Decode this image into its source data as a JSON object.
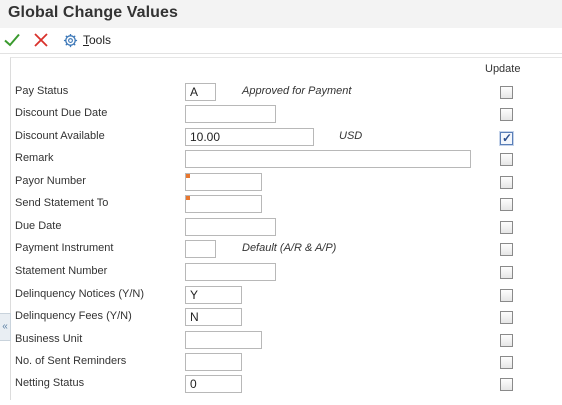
{
  "window": {
    "title": "Global Change Values"
  },
  "toolbar": {
    "tools_label": "Tools",
    "tools_underline": "T",
    "tools_rest": "ools"
  },
  "columns": {
    "update": "Update"
  },
  "fields": {
    "pay_status": {
      "label": "Pay Status",
      "value": "A",
      "description": "Approved for Payment"
    },
    "discount_due_date": {
      "label": "Discount Due Date",
      "value": ""
    },
    "discount_available": {
      "label": "Discount Available",
      "value": "10.00",
      "currency": "USD"
    },
    "remark": {
      "label": "Remark",
      "value": ""
    },
    "payor_number": {
      "label": "Payor Number",
      "value": ""
    },
    "send_statement_to": {
      "label": "Send Statement To",
      "value": ""
    },
    "due_date": {
      "label": "Due Date",
      "value": ""
    },
    "payment_instrument": {
      "label": "Payment Instrument",
      "value": "",
      "description": "Default (A/R & A/P)"
    },
    "statement_number": {
      "label": "Statement Number",
      "value": ""
    },
    "delinquency_notices": {
      "label": "Delinquency Notices (Y/N)",
      "value": "Y"
    },
    "delinquency_fees": {
      "label": "Delinquency Fees (Y/N)",
      "value": "N"
    },
    "business_unit": {
      "label": "Business Unit",
      "value": ""
    },
    "sent_reminders": {
      "label": "No. of Sent Reminders",
      "value": ""
    },
    "netting_status": {
      "label": "Netting Status",
      "value": "0"
    }
  },
  "update_checked": [
    "discount_available"
  ],
  "colors": {
    "required_marker": "#e8772e",
    "ok_icon": "#3a9a2e",
    "cancel_icon": "#d9312b"
  }
}
